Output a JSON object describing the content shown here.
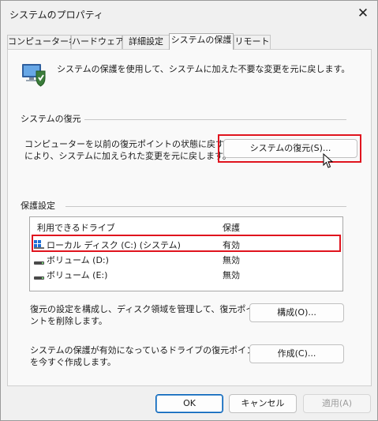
{
  "window": {
    "title": "システムのプロパティ",
    "close_glyph": "✕"
  },
  "tabs": [
    {
      "label": "コンピューター名"
    },
    {
      "label": "ハードウェア"
    },
    {
      "label": "詳細設定"
    },
    {
      "label": "システムの保護",
      "active": true
    },
    {
      "label": "リモート"
    }
  ],
  "intro_text": "システムの保護を使用して、システムに加えた不要な変更を元に戻します。",
  "restore": {
    "group_label": "システムの復元",
    "desc_line1": "コンピューターを以前の復元ポイントの状態に戻すこと",
    "desc_line2": "により、システムに加えられた変更を元に戻します。",
    "button_label": "システムの復元(S)..."
  },
  "protection": {
    "group_label": "保護設定",
    "columns": {
      "drive": "利用できるドライブ",
      "status": "保護"
    },
    "drives": [
      {
        "name": "ローカル ディスク (C:) (システム)",
        "status": "有効",
        "icon": "windows-drive-icon"
      },
      {
        "name": "ボリューム (D:)",
        "status": "無効",
        "icon": "drive-icon"
      },
      {
        "name": "ボリューム (E:)",
        "status": "無効",
        "icon": "drive-icon"
      }
    ],
    "configure_desc_line1": "復元の設定を構成し、ディスク領域を管理して、復元ポイ",
    "configure_desc_line2": "ントを削除します。",
    "configure_button": "構成(O)...",
    "create_desc_line1": "システムの保護が有効になっているドライブの復元ポイント",
    "create_desc_line2": "を今すぐ作成します。",
    "create_button": "作成(C)..."
  },
  "footer": {
    "ok": "OK",
    "cancel": "キャンセル",
    "apply": "適用(A)"
  },
  "colors": {
    "highlight": "#e0141e",
    "accent": "#005fb8"
  }
}
